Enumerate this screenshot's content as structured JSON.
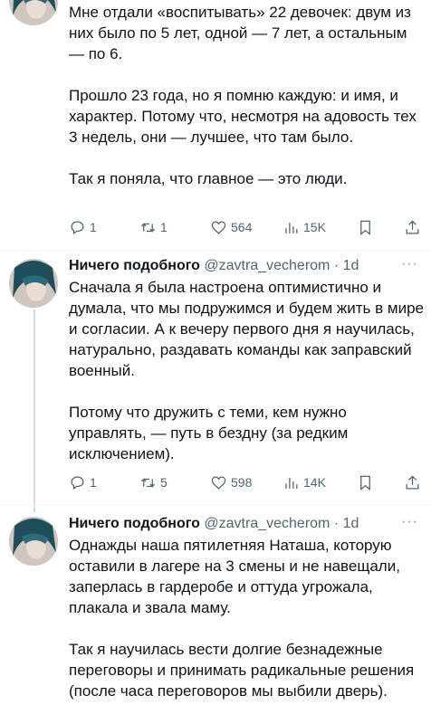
{
  "tweets": [
    {
      "name": "",
      "handle": "",
      "time": "",
      "paragraphs": [
        "Мне отдали «воспитывать» 22 девочек: двум из них было по 5 лет, одной — 7 лет, а остальным — по 6.",
        "Прошло 23 года, но я помню каждую: и имя, и характер. Потому что, несмотря на адовость тех 3 недель, они — лучшее, что там было.",
        "Так я поняла, что главное — это люди."
      ],
      "stats": {
        "replies": "1",
        "reposts": "1",
        "likes": "564",
        "views": "15K"
      }
    },
    {
      "name": "Ничего подобного",
      "handle": "@zavtra_vecherom",
      "time": "· 1d",
      "paragraphs": [
        "Сначала я была настроена оптимистично и думала, что мы подружимся и будем жить в мире и согласии. А к вечеру первого дня я научилась, натурально, раздавать команды как заправский военный.",
        "Потому что дружить с теми, кем нужно управлять, — путь в бездну (за редким исключением)."
      ],
      "stats": {
        "replies": "1",
        "reposts": "5",
        "likes": "598",
        "views": "14K"
      }
    },
    {
      "name": "Ничего подобного",
      "handle": "@zavtra_vecherom",
      "time": "· 1d",
      "paragraphs": [
        "Однажды наша пятилетняя Наташа, которую оставили в лагере на 3 смены и не навещали, заперлась в гардеробе и оттуда угрожала, плакала и звала маму.",
        "Так я научилась вести долгие безнадежные переговоры и принимать радикальные решения (после часа переговоров мы выбили дверь)."
      ]
    }
  ],
  "more_label": "···",
  "icons": {
    "reply": "reply-icon",
    "repost": "repost-icon",
    "like": "heart-icon",
    "views": "views-icon",
    "bookmark": "bookmark-icon",
    "share": "share-icon"
  },
  "colors": {
    "text": "#0f1419",
    "secondary": "#536471",
    "thread_line": "#cfd9de"
  }
}
